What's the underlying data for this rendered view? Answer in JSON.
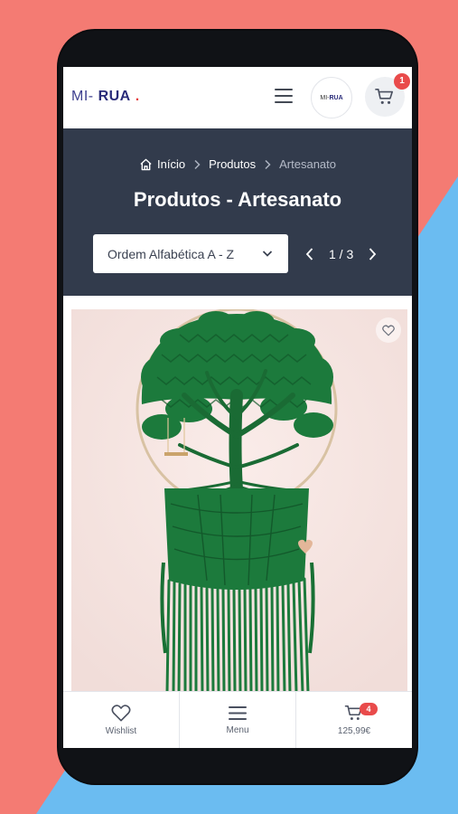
{
  "colors": {
    "background_left": "#f47b73",
    "background_right": "#6bbcf1",
    "hero_bg": "#323b4c",
    "badge": "#e94b4b",
    "product_bg": "#f7e6e3",
    "macrame_green": "#1c7a3c"
  },
  "header": {
    "logo_prefix": "MI-",
    "logo_main": "RUA",
    "logo_dot": ".",
    "avatar_prefix": "MI-",
    "avatar_main": "RUA",
    "menu_icon": "hamburger-icon",
    "cart_icon": "cart-icon",
    "cart_count": "1"
  },
  "breadcrumb": {
    "home_icon": "home-icon",
    "home": "Início",
    "products": "Produtos",
    "current": "Artesanato"
  },
  "page_title": "Produtos - Artesanato",
  "sort": {
    "selected": "Ordem Alfabética A - Z"
  },
  "pagination": {
    "label": "1 / 3"
  },
  "product": {
    "wishlist_icon": "heart-icon"
  },
  "bottom_nav": {
    "wishlist_label": "Wishlist",
    "menu_label": "Menu",
    "cart_count": "4",
    "cart_total": "125,99€"
  }
}
